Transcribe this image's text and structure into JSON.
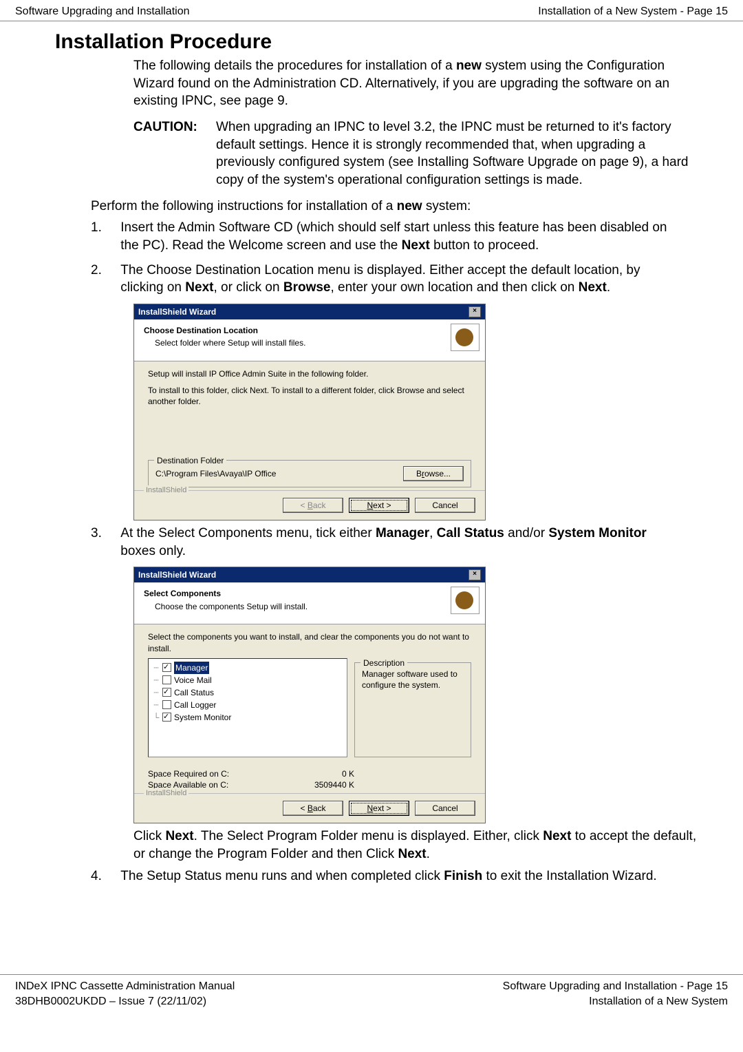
{
  "header": {
    "left": "Software Upgrading and Installation",
    "right": "Installation of a New System - Page 15"
  },
  "section_title": "Installation Procedure",
  "intro": {
    "p1a": "The following details the procedures for installation of a ",
    "p1_bold": "new",
    "p1b": " system using the Configuration Wizard found on the Administration CD. Alternatively, if you are upgrading the software on an existing IPNC, see page 9.",
    "caution_label": "CAUTION:",
    "caution_text": "When upgrading an IPNC to level 3.2, the IPNC must be returned to it's factory default settings. Hence it is strongly recommended that, when upgrading a previously configured system (see Installing Software Upgrade on page 9), a hard copy of the system's operational configuration settings is made."
  },
  "perform_a": "Perform the following instructions for installation of a ",
  "perform_bold": "new",
  "perform_b": " system:",
  "steps": {
    "s1": {
      "num": "1.",
      "a": "Insert the Admin Software CD (which should self start unless this feature has been disabled on the PC). Read the Welcome screen and use the ",
      "b_bold": "Next",
      "c": " button to proceed."
    },
    "s2": {
      "num": "2.",
      "a": "The Choose Destination Location menu is displayed. Either accept the default location, by clicking on ",
      "next": "Next",
      "b": ", or click on ",
      "browse": "Browse",
      "c": ", enter your own location and then click on ",
      "next2": "Next",
      "d": "."
    },
    "s3": {
      "num": "3.",
      "a": "At the Select Components menu, tick either ",
      "mgr": "Manager",
      "sep1": ", ",
      "cs": "Call Status",
      "b": " and/or ",
      "sm": "System Monitor",
      "c": " boxes only."
    },
    "s3b": {
      "a": "Click ",
      "next": "Next",
      "b": ". The Select Program Folder menu is displayed. Either, click ",
      "next2": "Next",
      "c": " to accept the default, or change the Program Folder and then Click ",
      "next3": "Next",
      "d": "."
    },
    "s4": {
      "num": "4.",
      "a": "The Setup Status menu runs and when completed click ",
      "finish": "Finish",
      "b": " to exit the Installation Wizard."
    }
  },
  "dlg1": {
    "title": "InstallShield Wizard",
    "h_title": "Choose Destination Location",
    "h_sub": "Select folder where Setup will install files.",
    "line1": "Setup will install IP Office Admin Suite in the following folder.",
    "line2": "To install to this folder, click Next. To install to a different folder, click Browse and select another folder.",
    "dest_legend": "Destination Folder",
    "dest_path": "C:\\Program Files\\Avaya\\IP Office",
    "browse": "Browse...",
    "installshield": "InstallShield",
    "back": "< Back",
    "next": "Next >",
    "cancel": "Cancel"
  },
  "dlg2": {
    "title": "InstallShield Wizard",
    "h_title": "Select Components",
    "h_sub": "Choose the components Setup will install.",
    "instr": "Select the components you want to install, and clear the components you do not want to install.",
    "items": {
      "manager_label": "Manager",
      "voice_label": "Voice Mail",
      "callstatus_label": "Call Status",
      "calllogger_label": "Call Logger",
      "sysmon_label": "System Monitor"
    },
    "desc_legend": "Description",
    "desc_text": "Manager software used to configure the system.",
    "space_req_label": "Space Required on  C:",
    "space_req_val": "0 K",
    "space_avail_label": "Space Available on  C:",
    "space_avail_val": "3509440 K",
    "installshield": "InstallShield",
    "back": "< Back",
    "next": "Next >",
    "cancel": "Cancel"
  },
  "chart_data": {
    "type": "table",
    "title": "Select Components",
    "rows": [
      {
        "component": "Manager",
        "checked": true,
        "selected": true
      },
      {
        "component": "Voice Mail",
        "checked": false,
        "selected": false
      },
      {
        "component": "Call Status",
        "checked": true,
        "selected": false
      },
      {
        "component": "Call Logger",
        "checked": false,
        "selected": false
      },
      {
        "component": "System Monitor",
        "checked": true,
        "selected": false
      }
    ],
    "space_required_on_c_k": 0,
    "space_available_on_c_k": 3509440
  },
  "footer": {
    "left1": "INDeX IPNC Cassette Administration Manual",
    "left2": "38DHB0002UKDD – Issue 7 (22/11/02)",
    "right1": "Software Upgrading and Installation - Page 15",
    "right2": "Installation of a New System"
  }
}
